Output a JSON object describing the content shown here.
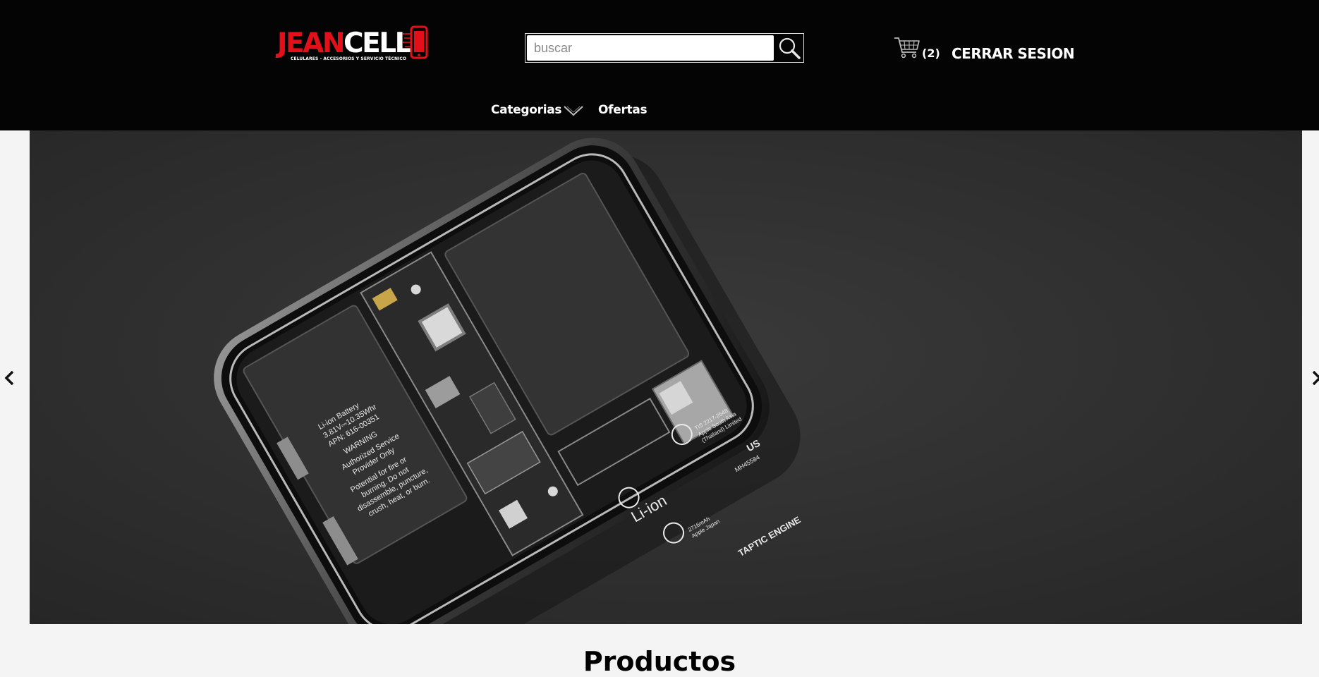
{
  "header": {
    "logo": {
      "brand_part1": "JEAN",
      "brand_part2": "CELL",
      "tagline": "CELULARES - ACCESORIOS Y SERVICIO TÉCNICO"
    },
    "search": {
      "placeholder": "buscar",
      "value": ""
    },
    "cart": {
      "count_label": "(2)"
    },
    "logout_label": "CERRAR SESION"
  },
  "nav": {
    "items": [
      {
        "label": "Categorias",
        "has_dropdown": true
      },
      {
        "label": "Ofertas",
        "has_dropdown": false
      }
    ]
  },
  "hero": {
    "image_alt": "iPhone interior",
    "battery_text": [
      "Li-ion Battery",
      "3.81V⎓10.35Whr",
      "APN: 616-00351",
      "WARNING",
      "Authorized Service",
      "Provider Only",
      "Potential for fire or",
      "burning. Do not",
      "disassemble, puncture,",
      "crush, heat, or burn."
    ],
    "battery2_text": [
      "Li-ion",
      "TIS 2217-2548",
      "Apple South Asia",
      "(Thailand) Limited",
      "MH45584",
      "2716mAh",
      "Apple Japan",
      "US"
    ],
    "taptic_label": "TAPTIC ENGINE"
  },
  "section": {
    "title": "Productos"
  },
  "colors": {
    "header_bg": "#040404",
    "brand_red": "#e3101a",
    "page_bg": "#f4f4f4"
  }
}
